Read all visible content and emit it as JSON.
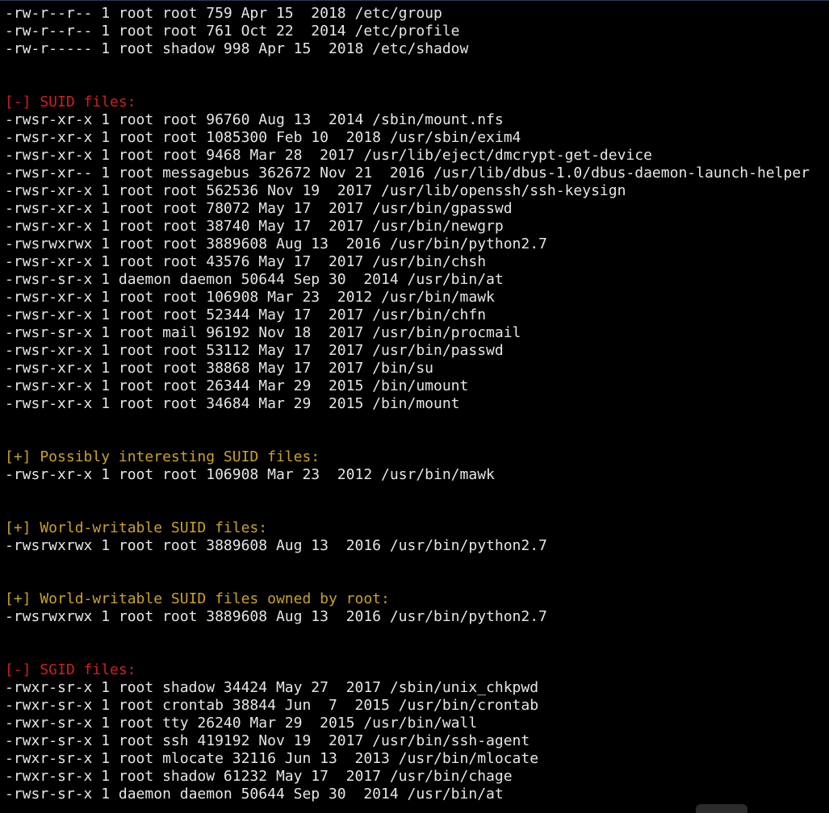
{
  "colors": {
    "background": "#000000",
    "text": "#e6e6e6",
    "warning_header": "#d11f1f",
    "info_header": "#c9a227"
  },
  "lines": [
    {
      "kind": "text",
      "text": "-rw-r--r-- 1 root root 759 Apr 15  2018 /etc/group"
    },
    {
      "kind": "text",
      "text": "-rw-r--r-- 1 root root 761 Oct 22  2014 /etc/profile"
    },
    {
      "kind": "text",
      "text": "-rw-r----- 1 root shadow 998 Apr 15  2018 /etc/shadow"
    },
    {
      "kind": "blank",
      "text": ""
    },
    {
      "kind": "blank",
      "text": ""
    },
    {
      "kind": "warn",
      "text": "[-] SUID files:"
    },
    {
      "kind": "text",
      "text": "-rwsr-xr-x 1 root root 96760 Aug 13  2014 /sbin/mount.nfs"
    },
    {
      "kind": "text",
      "text": "-rwsr-xr-x 1 root root 1085300 Feb 10  2018 /usr/sbin/exim4"
    },
    {
      "kind": "text",
      "text": "-rwsr-xr-x 1 root root 9468 Mar 28  2017 /usr/lib/eject/dmcrypt-get-device"
    },
    {
      "kind": "text",
      "text": "-rwsr-xr-- 1 root messagebus 362672 Nov 21  2016 /usr/lib/dbus-1.0/dbus-daemon-launch-helper"
    },
    {
      "kind": "text",
      "text": "-rwsr-xr-x 1 root root 562536 Nov 19  2017 /usr/lib/openssh/ssh-keysign"
    },
    {
      "kind": "text",
      "text": "-rwsr-xr-x 1 root root 78072 May 17  2017 /usr/bin/gpasswd"
    },
    {
      "kind": "text",
      "text": "-rwsr-xr-x 1 root root 38740 May 17  2017 /usr/bin/newgrp"
    },
    {
      "kind": "text",
      "text": "-rwsrwxrwx 1 root root 3889608 Aug 13  2016 /usr/bin/python2.7"
    },
    {
      "kind": "text",
      "text": "-rwsr-xr-x 1 root root 43576 May 17  2017 /usr/bin/chsh"
    },
    {
      "kind": "text",
      "text": "-rwsr-sr-x 1 daemon daemon 50644 Sep 30  2014 /usr/bin/at"
    },
    {
      "kind": "text",
      "text": "-rwsr-xr-x 1 root root 106908 Mar 23  2012 /usr/bin/mawk"
    },
    {
      "kind": "text",
      "text": "-rwsr-xr-x 1 root root 52344 May 17  2017 /usr/bin/chfn"
    },
    {
      "kind": "text",
      "text": "-rwsr-sr-x 1 root mail 96192 Nov 18  2017 /usr/bin/procmail"
    },
    {
      "kind": "text",
      "text": "-rwsr-xr-x 1 root root 53112 May 17  2017 /usr/bin/passwd"
    },
    {
      "kind": "text",
      "text": "-rwsr-xr-x 1 root root 38868 May 17  2017 /bin/su"
    },
    {
      "kind": "text",
      "text": "-rwsr-xr-x 1 root root 26344 Mar 29  2015 /bin/umount"
    },
    {
      "kind": "text",
      "text": "-rwsr-xr-x 1 root root 34684 Mar 29  2015 /bin/mount"
    },
    {
      "kind": "blank",
      "text": ""
    },
    {
      "kind": "blank",
      "text": ""
    },
    {
      "kind": "info",
      "text": "[+] Possibly interesting SUID files:"
    },
    {
      "kind": "text",
      "text": "-rwsr-xr-x 1 root root 106908 Mar 23  2012 /usr/bin/mawk"
    },
    {
      "kind": "blank",
      "text": ""
    },
    {
      "kind": "blank",
      "text": ""
    },
    {
      "kind": "info",
      "text": "[+] World-writable SUID files:"
    },
    {
      "kind": "text",
      "text": "-rwsrwxrwx 1 root root 3889608 Aug 13  2016 /usr/bin/python2.7"
    },
    {
      "kind": "blank",
      "text": ""
    },
    {
      "kind": "blank",
      "text": ""
    },
    {
      "kind": "info",
      "text": "[+] World-writable SUID files owned by root:"
    },
    {
      "kind": "text",
      "text": "-rwsrwxrwx 1 root root 3889608 Aug 13  2016 /usr/bin/python2.7"
    },
    {
      "kind": "blank",
      "text": ""
    },
    {
      "kind": "blank",
      "text": ""
    },
    {
      "kind": "warn",
      "text": "[-] SGID files:"
    },
    {
      "kind": "text",
      "text": "-rwxr-sr-x 1 root shadow 34424 May 27  2017 /sbin/unix_chkpwd"
    },
    {
      "kind": "text",
      "text": "-rwxr-sr-x 1 root crontab 38844 Jun  7  2015 /usr/bin/crontab"
    },
    {
      "kind": "text",
      "text": "-rwxr-sr-x 1 root tty 26240 Mar 29  2015 /usr/bin/wall"
    },
    {
      "kind": "text",
      "text": "-rwxr-sr-x 1 root ssh 419192 Nov 19  2017 /usr/bin/ssh-agent"
    },
    {
      "kind": "text",
      "text": "-rwxr-sr-x 1 root mlocate 32116 Jun 13  2013 /usr/bin/mlocate"
    },
    {
      "kind": "text",
      "text": "-rwxr-sr-x 1 root shadow 61232 May 17  2017 /usr/bin/chage"
    },
    {
      "kind": "text",
      "text": "-rwsr-sr-x 1 daemon daemon 50644 Sep 30  2014 /usr/bin/at"
    }
  ]
}
